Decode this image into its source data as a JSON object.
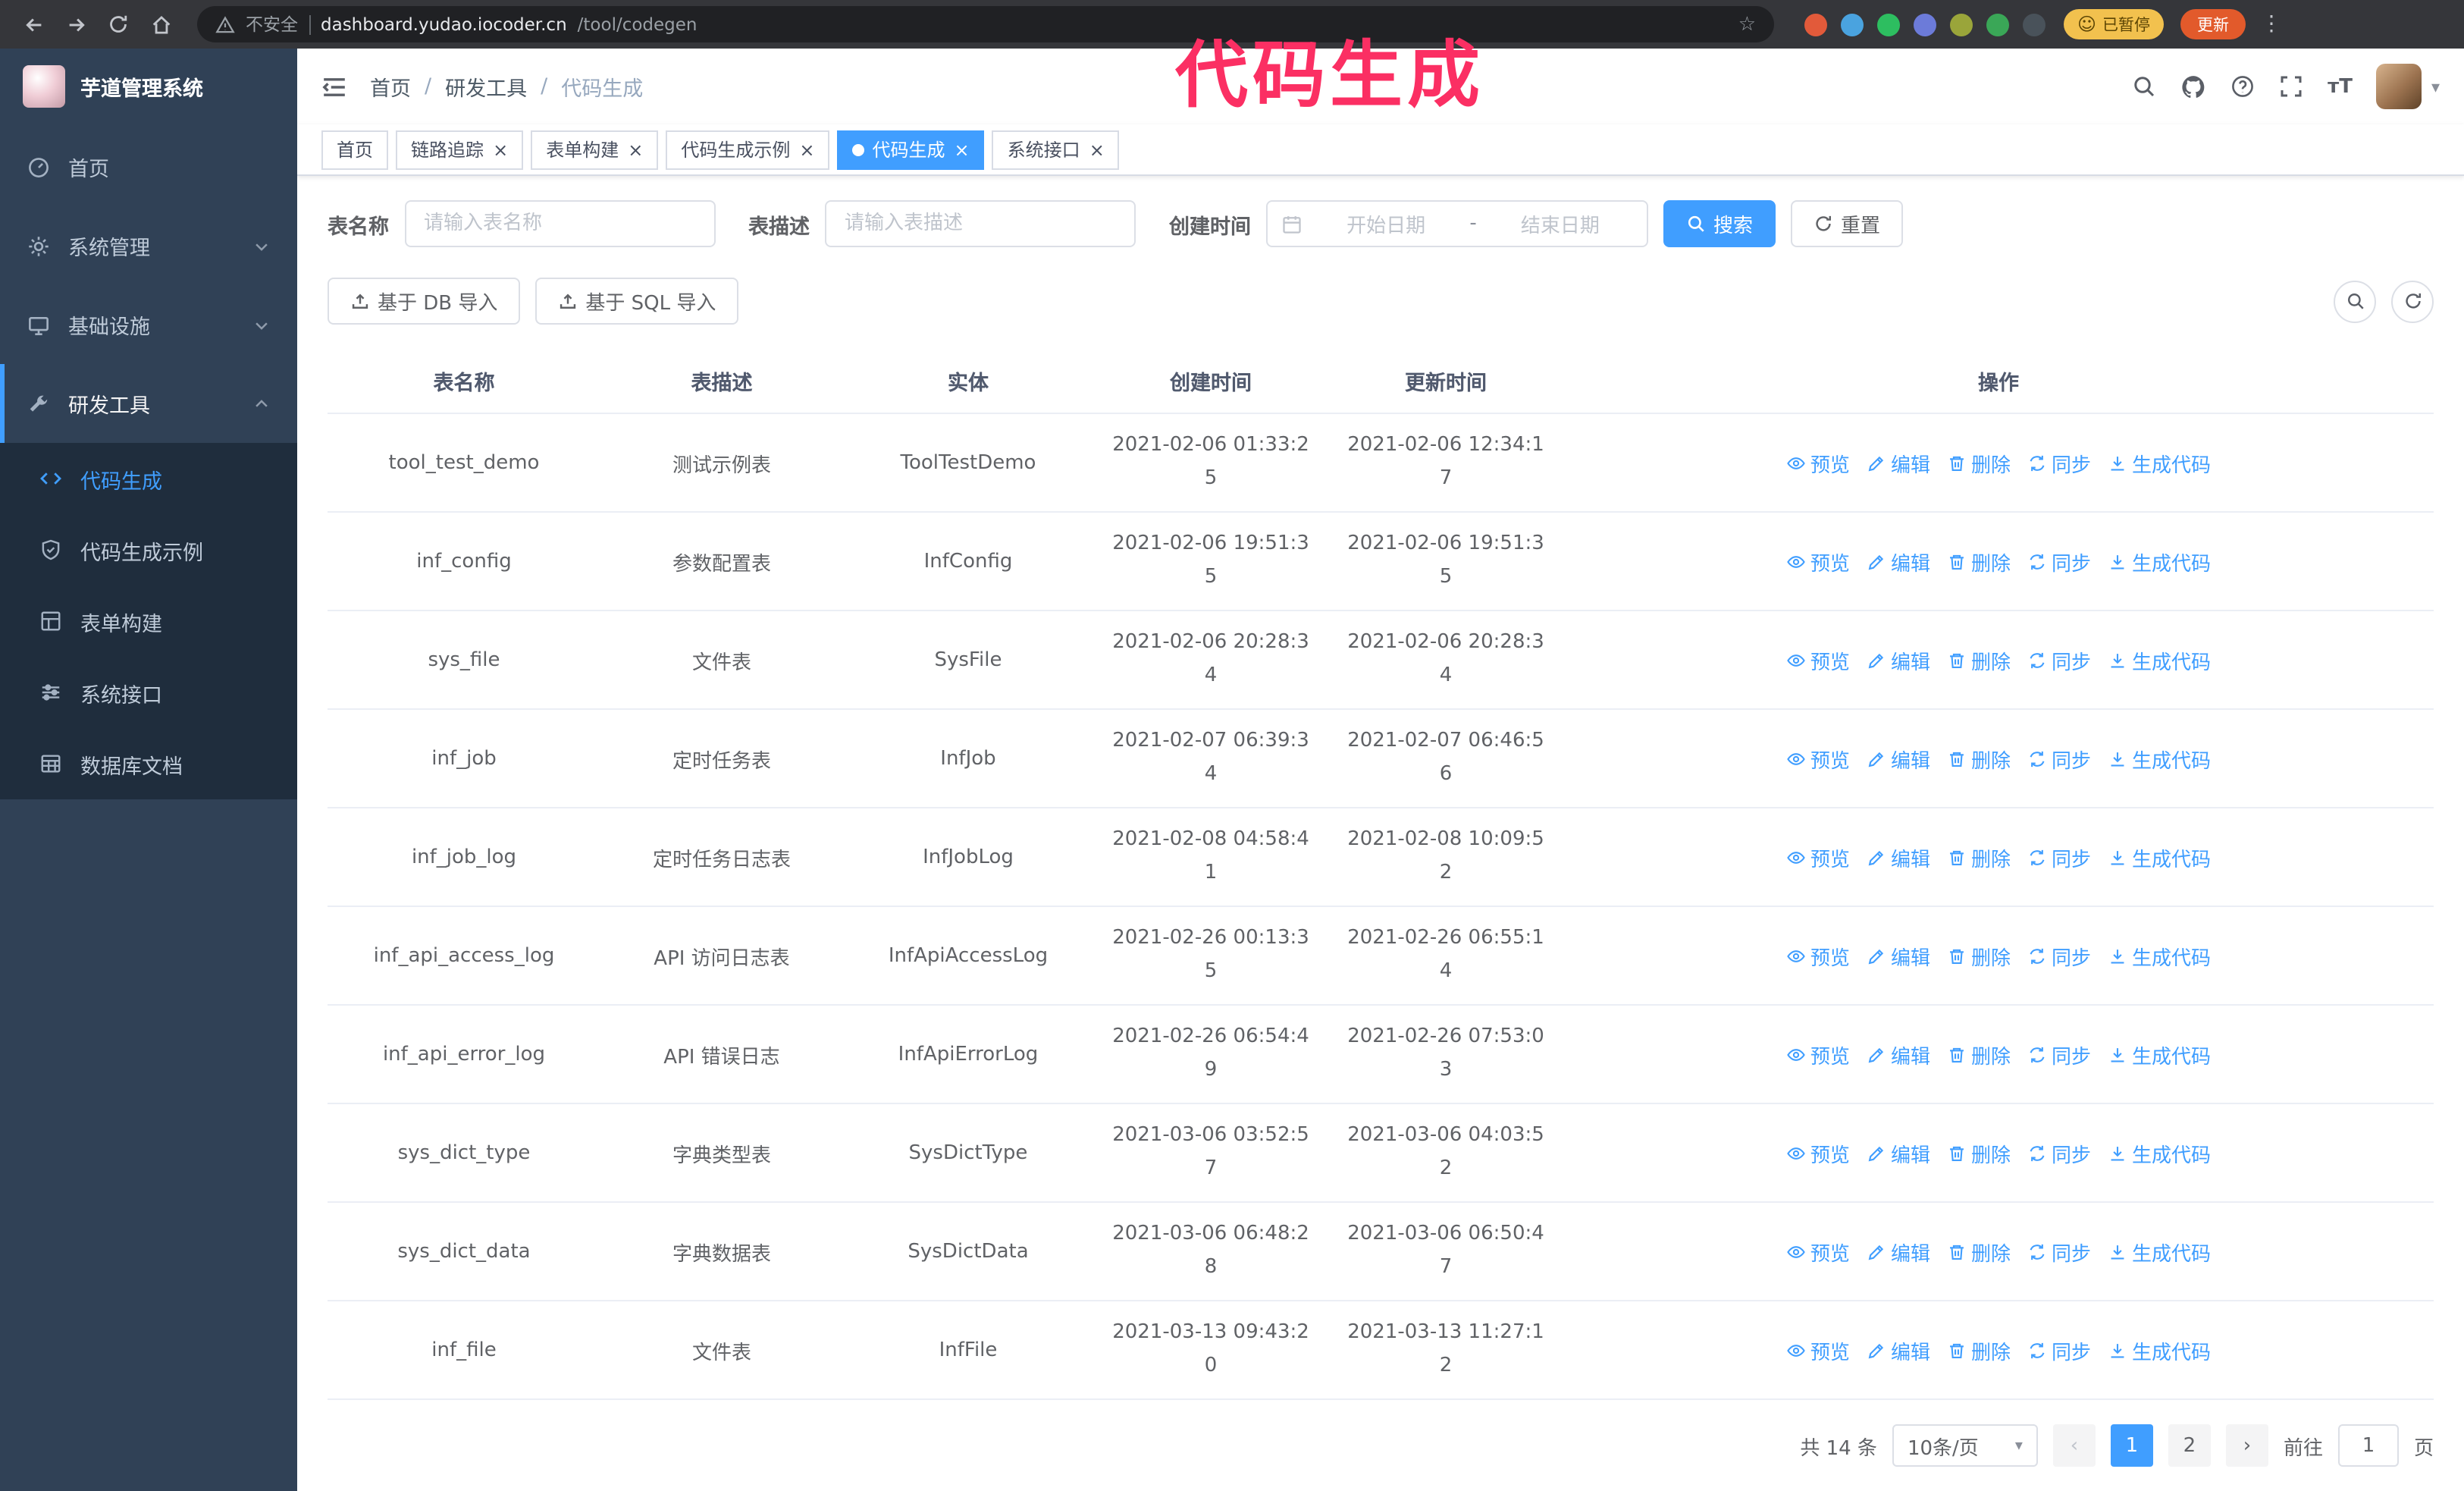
{
  "colors": {
    "primary": "#409eff",
    "sidebar_bg": "#304156",
    "submenu_bg": "#1f2d3d",
    "annotation": "#fb2f63",
    "link": "#409eff"
  },
  "icons": {
    "star": "☆",
    "kebab": "⋮",
    "smiley": "☺",
    "caret_down": "▾",
    "close": "×",
    "font_size": "тT",
    "prev": "‹",
    "next": "›"
  },
  "browser": {
    "security_warning": "不安全",
    "url_domain": "dashboard.yudao.iocoder.cn",
    "url_path": "/tool/codegen",
    "paused_badge": "已暂停",
    "update_button": "更新",
    "extension_colors": [
      "#e25a3a",
      "#4aa3df",
      "#2dbe60",
      "#6c7bd9",
      "#9aa53a",
      "#3aa757",
      "#49525a"
    ]
  },
  "annotation": "代码生成",
  "sidebar": {
    "logo_title": "芋道管理系统",
    "items": [
      {
        "label": "首页"
      },
      {
        "label": "系统管理"
      },
      {
        "label": "基础设施"
      },
      {
        "label": "研发工具"
      }
    ],
    "subitems": [
      {
        "label": "代码生成",
        "active": true
      },
      {
        "label": "代码生成示例"
      },
      {
        "label": "表单构建"
      },
      {
        "label": "系统接口"
      },
      {
        "label": "数据库文档"
      }
    ]
  },
  "navbar": {
    "breadcrumb": [
      "首页",
      "研发工具",
      "代码生成"
    ],
    "separator": "/"
  },
  "tabs": [
    {
      "label": "首页",
      "closable": false,
      "active": false
    },
    {
      "label": "链路追踪",
      "closable": true,
      "active": false
    },
    {
      "label": "表单构建",
      "closable": true,
      "active": false
    },
    {
      "label": "代码生成示例",
      "closable": true,
      "active": false
    },
    {
      "label": "代码生成",
      "closable": true,
      "active": true
    },
    {
      "label": "系统接口",
      "closable": true,
      "active": false
    }
  ],
  "filters": {
    "table_name_label": "表名称",
    "table_name_placeholder": "请输入表名称",
    "table_desc_label": "表描述",
    "table_desc_placeholder": "请输入表描述",
    "create_time_label": "创建时间",
    "date_start_placeholder": "开始日期",
    "date_separator": "-",
    "date_end_placeholder": "结束日期",
    "search_button": "搜索",
    "reset_button": "重置"
  },
  "toolbar": {
    "import_db_button": "基于 DB 导入",
    "import_sql_button": "基于 SQL 导入"
  },
  "table": {
    "columns": [
      "表名称",
      "表描述",
      "实体",
      "创建时间",
      "更新时间",
      "操作"
    ],
    "actions": [
      "预览",
      "编辑",
      "删除",
      "同步",
      "生成代码"
    ],
    "rows": [
      {
        "name": "tool_test_demo",
        "desc": "测试示例表",
        "entity": "ToolTestDemo",
        "created": "2021-02-06 01:33:25",
        "updated": "2021-02-06 12:34:17"
      },
      {
        "name": "inf_config",
        "desc": "参数配置表",
        "entity": "InfConfig",
        "created": "2021-02-06 19:51:35",
        "updated": "2021-02-06 19:51:35"
      },
      {
        "name": "sys_file",
        "desc": "文件表",
        "entity": "SysFile",
        "created": "2021-02-06 20:28:34",
        "updated": "2021-02-06 20:28:34"
      },
      {
        "name": "inf_job",
        "desc": "定时任务表",
        "entity": "InfJob",
        "created": "2021-02-07 06:39:34",
        "updated": "2021-02-07 06:46:56"
      },
      {
        "name": "inf_job_log",
        "desc": "定时任务日志表",
        "entity": "InfJobLog",
        "created": "2021-02-08 04:58:41",
        "updated": "2021-02-08 10:09:52"
      },
      {
        "name": "inf_api_access_log",
        "desc": "API 访问日志表",
        "entity": "InfApiAccessLog",
        "created": "2021-02-26 00:13:35",
        "updated": "2021-02-26 06:55:14"
      },
      {
        "name": "inf_api_error_log",
        "desc": "API 错误日志",
        "entity": "InfApiErrorLog",
        "created": "2021-02-26 06:54:49",
        "updated": "2021-02-26 07:53:03"
      },
      {
        "name": "sys_dict_type",
        "desc": "字典类型表",
        "entity": "SysDictType",
        "created": "2021-03-06 03:52:57",
        "updated": "2021-03-06 04:03:52"
      },
      {
        "name": "sys_dict_data",
        "desc": "字典数据表",
        "entity": "SysDictData",
        "created": "2021-03-06 06:48:28",
        "updated": "2021-03-06 06:50:47"
      },
      {
        "name": "inf_file",
        "desc": "文件表",
        "entity": "InfFile",
        "created": "2021-03-13 09:43:20",
        "updated": "2021-03-13 11:27:12"
      }
    ]
  },
  "pagination": {
    "total": "共 14 条",
    "page_size": "10条/页",
    "pages": [
      "1",
      "2"
    ],
    "goto_label": "前往",
    "goto_value": "1",
    "goto_suffix": "页"
  }
}
